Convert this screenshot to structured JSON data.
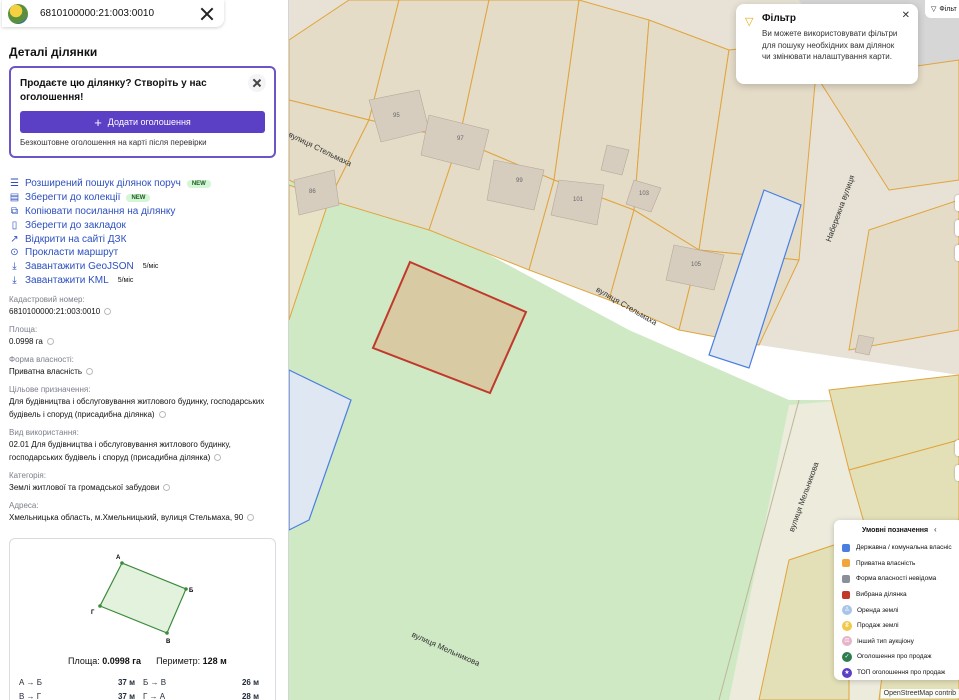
{
  "search": {
    "value": "6810100000:21:003:0010"
  },
  "panel": {
    "title": "Деталі ділянки",
    "promo": {
      "title": "Продаєте цю ділянку? Створіть у нас оголошення!",
      "button": "Додати оголошення",
      "note": "Безкоштовне оголошення на карті після перевірки"
    },
    "actions": [
      {
        "label": "Розширений пошук ділянок поруч",
        "icon": "sliders-icon",
        "badge": "NEW"
      },
      {
        "label": "Зберегти до колекції",
        "icon": "collection-icon",
        "badge": "NEW"
      },
      {
        "label": "Копіювати посилання на ділянку",
        "icon": "link-icon"
      },
      {
        "label": "Зберегти до закладок",
        "icon": "bookmark-icon"
      },
      {
        "label": "Відкрити на сайті ДЗК",
        "icon": "external-link-icon"
      },
      {
        "label": "Прокласти маршрут",
        "icon": "location-pin-icon"
      },
      {
        "label": "Завантажити GeoJSON",
        "icon": "download-icon",
        "limit": "5/міс"
      },
      {
        "label": "Завантажити KML",
        "icon": "download-icon",
        "limit": "5/міс"
      }
    ],
    "properties": {
      "cadastral": {
        "label": "Кадастровий номер:",
        "value": "6810100000:21:003:0010"
      },
      "area": {
        "label": "Площа:",
        "value": "0.0998 га"
      },
      "ownership": {
        "label": "Форма власності:",
        "value": "Приватна власність"
      },
      "purpose": {
        "label": "Цільове призначення:",
        "value": "Для будівництва і обслуговування житлового будинку, господарських будівель і споруд (присадибна ділянка)"
      },
      "usage": {
        "label": "Вид використання:",
        "value": "02.01 Для будівництва і обслуговування житлового будинку, господарських будівель і споруд (присадибна ділянка)"
      },
      "category": {
        "label": "Категорія:",
        "value": "Землі житлової та громадської забудови"
      },
      "address": {
        "label": "Адреса:",
        "value": "Хмельницька область, м.Хмельницький, вулиця Стельмаха, 90"
      }
    },
    "shape": {
      "vertices": [
        "А",
        "Б",
        "В",
        "Г"
      ],
      "area_label": "Площа:",
      "area_value": "0.0998 га",
      "perimeter_label": "Периметр:",
      "perimeter_value": "128 м",
      "sides": [
        {
          "name": "А → Б",
          "length": "37 м"
        },
        {
          "name": "Б → В",
          "length": "26 м"
        },
        {
          "name": "В → Г",
          "length": "37 м"
        },
        {
          "name": "Г → А",
          "length": "28 м"
        }
      ]
    }
  },
  "map": {
    "streets": [
      "вулиця Стельмаха",
      "вулиця Стельмаха",
      "Набережна вулиця",
      "вулиця Мельникова",
      "вулиця Мельникова"
    ],
    "house_numbers": [
      "95",
      "97",
      "99",
      "101",
      "103",
      "105",
      "86"
    ],
    "filter_tip": {
      "title": "Фільтр",
      "text": "Ви можете використовувати фільтри для пошуку необхідних вам ділянок чи змінювати налаштування карти."
    },
    "filter_button": "Фільт",
    "legend": {
      "title": "Умовні позначення",
      "items": [
        {
          "label": "Державна / комунальна власніс",
          "color": "#4a7fe0",
          "kind": "square"
        },
        {
          "label": "Приватна власність",
          "color": "#f0a63a",
          "kind": "square"
        },
        {
          "label": "Форма власності невідома",
          "color": "#8a8f99",
          "kind": "square"
        },
        {
          "label": "Вибрана ділянка",
          "color": "#c0392b",
          "kind": "square"
        },
        {
          "label": "Оренда землі",
          "color": "#a9c4e8",
          "kind": "circle"
        },
        {
          "label": "Продаж землі",
          "color": "#f2c84b",
          "kind": "circle"
        },
        {
          "label": "Інший тип аукціону",
          "color": "#e6b3c9",
          "kind": "circle"
        },
        {
          "label": "Оголошення про продаж",
          "color": "#2e7d4f",
          "kind": "circle"
        },
        {
          "label": "ТОП оголошення про продаж",
          "color": "#5b3fc4",
          "kind": "circle"
        }
      ]
    },
    "attribution": "OpenStreetMap contrib"
  }
}
